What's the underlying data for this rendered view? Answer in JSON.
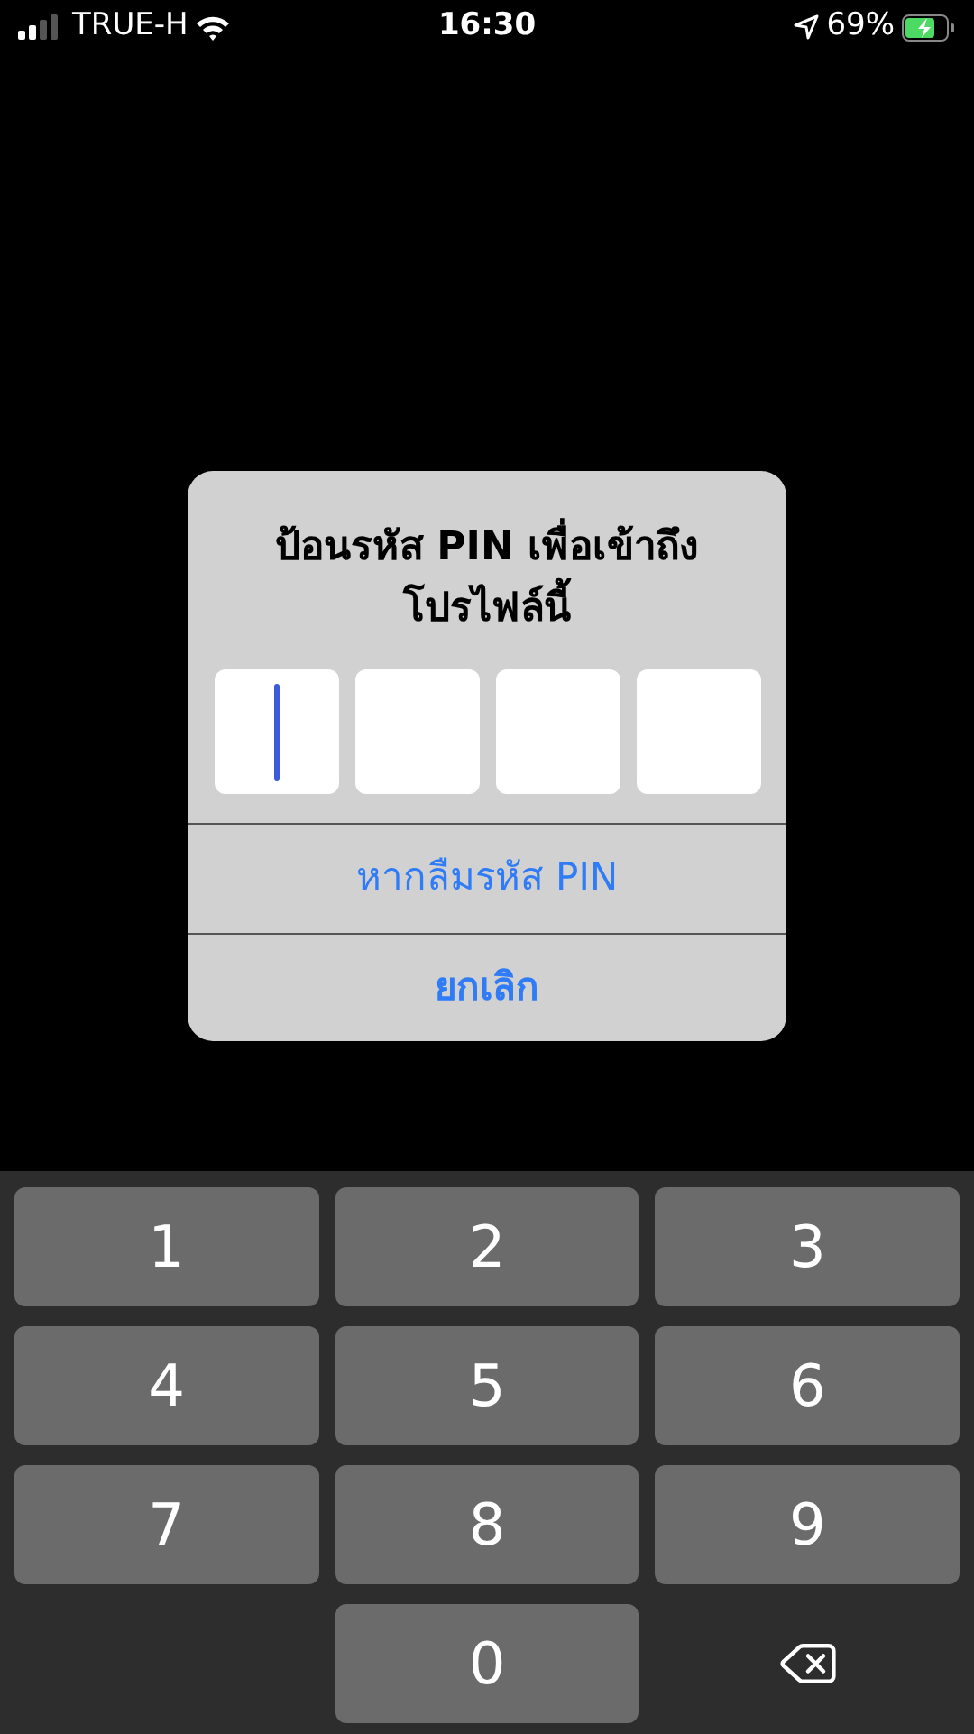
{
  "status_bar": {
    "carrier": "TRUE-H",
    "time": "16:30",
    "battery": "69%"
  },
  "dialog": {
    "title": "ป้อนรหัส PIN เพื่อเข้าถึงโปรไฟล์นี้",
    "pin_boxes": [
      {
        "focused": true
      },
      {
        "focused": false
      },
      {
        "focused": false
      },
      {
        "focused": false
      }
    ],
    "actions": [
      {
        "label": "หากลืมรหัส PIN",
        "bold": false
      },
      {
        "label": "ยกเลิก",
        "bold": true
      }
    ]
  },
  "keypad": [
    {
      "kind": "digit",
      "label": "1"
    },
    {
      "kind": "digit",
      "label": "2"
    },
    {
      "kind": "digit",
      "label": "3"
    },
    {
      "kind": "digit",
      "label": "4"
    },
    {
      "kind": "digit",
      "label": "5"
    },
    {
      "kind": "digit",
      "label": "6"
    },
    {
      "kind": "digit",
      "label": "7"
    },
    {
      "kind": "digit",
      "label": "8"
    },
    {
      "kind": "digit",
      "label": "9"
    },
    {
      "kind": "blank"
    },
    {
      "kind": "digit",
      "label": "0"
    },
    {
      "kind": "backspace"
    }
  ]
}
